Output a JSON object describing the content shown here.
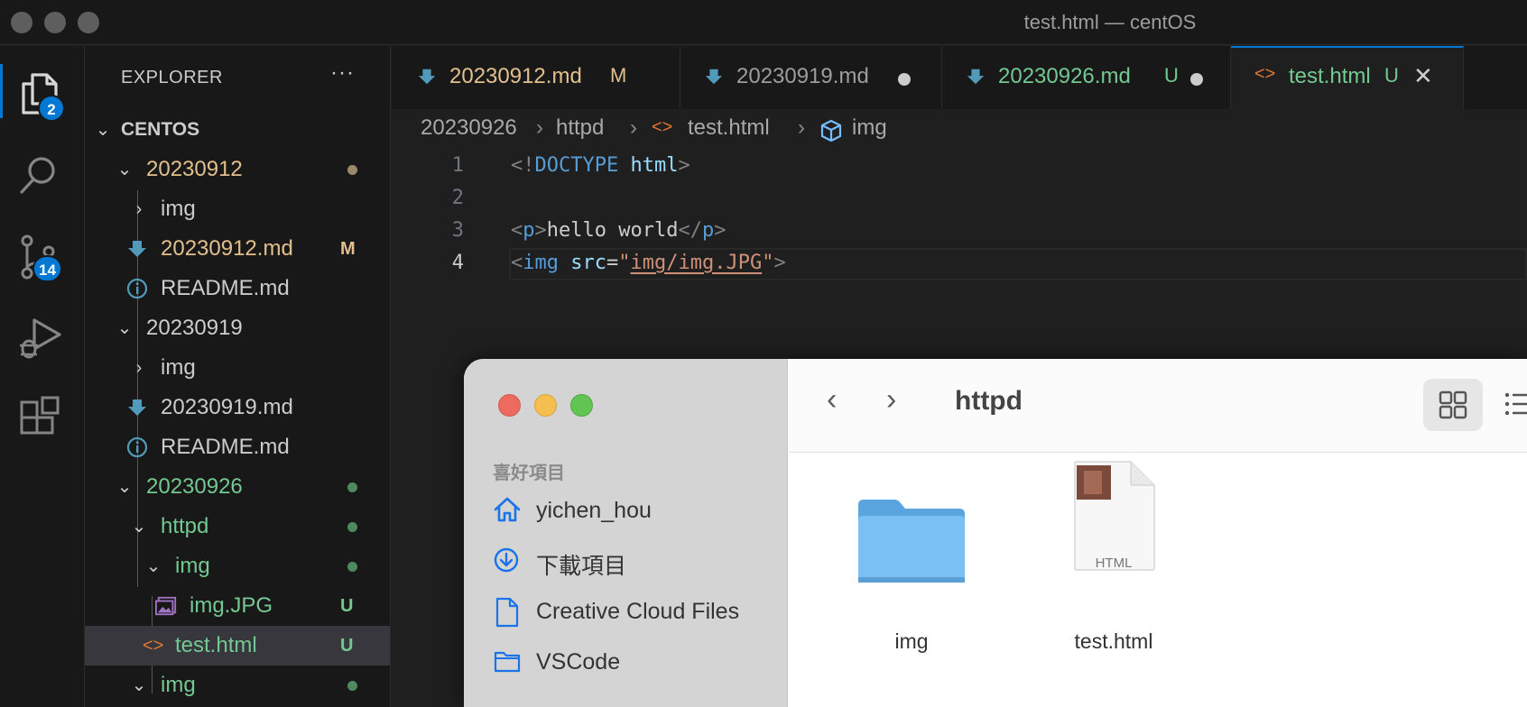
{
  "window": {
    "title": "test.html — centOS"
  },
  "activity": {
    "explorer_badge": "2",
    "scm_badge": "14",
    "icons": [
      "files-icon",
      "search-icon",
      "source-control-icon",
      "run-debug-icon",
      "extensions-icon"
    ]
  },
  "sidebar": {
    "header": "EXPLORER",
    "more": "···",
    "workspace": "CENTOS",
    "tree": [
      {
        "label": "20230912",
        "status": ""
      },
      {
        "label": "img",
        "status": ""
      },
      {
        "label": "20230912.md",
        "status": "M"
      },
      {
        "label": "README.md",
        "status": ""
      },
      {
        "label": "20230919",
        "status": ""
      },
      {
        "label": "img",
        "status": ""
      },
      {
        "label": "20230919.md",
        "status": ""
      },
      {
        "label": "README.md",
        "status": ""
      },
      {
        "label": "20230926",
        "status": ""
      },
      {
        "label": "httpd",
        "status": ""
      },
      {
        "label": "img",
        "status": ""
      },
      {
        "label": "img.JPG",
        "status": "U"
      },
      {
        "label": "test.html",
        "status": "U"
      },
      {
        "label": "img",
        "status": ""
      }
    ]
  },
  "tabs": [
    {
      "label": "20230912.md",
      "status": "M"
    },
    {
      "label": "20230919.md",
      "status": ""
    },
    {
      "label": "20230926.md",
      "status": "U"
    },
    {
      "label": "test.html",
      "status": "U",
      "close": "✕"
    }
  ],
  "breadcrumb": [
    "20230926",
    "httpd",
    "test.html",
    "img"
  ],
  "editor": {
    "line_numbers": [
      "1",
      "2",
      "3",
      "4"
    ],
    "line1": {
      "open": "<!",
      "keyword": "DOCTYPE",
      "name": "html",
      "close": ">"
    },
    "line3": {
      "lt": "<",
      "tag": "p",
      "gt": ">",
      "text": "hello world",
      "lt2": "</",
      "tag2": "p",
      "gt2": ">"
    },
    "line4": {
      "lt": "<",
      "tag": "img",
      "attr": "src",
      "eq": "=",
      "q1": "\"",
      "value": "img/img.JPG",
      "q2": "\"",
      "gt": ">"
    }
  },
  "finder": {
    "title": "httpd",
    "section": "喜好項目",
    "favorites": [
      {
        "label": "yichen_hou",
        "icon": "home-icon"
      },
      {
        "label": "下載項目",
        "icon": "download-icon"
      },
      {
        "label": "Creative Cloud Files",
        "icon": "document-icon"
      },
      {
        "label": "VSCode",
        "icon": "folder-icon"
      }
    ],
    "files": [
      {
        "label": "img",
        "icon": "folder-icon"
      },
      {
        "label": "test.html",
        "icon": "html-file-icon",
        "badge": "HTML"
      }
    ],
    "nav_back": "‹",
    "nav_forward": "›"
  },
  "colors": {
    "accent": "#0078d4",
    "modified": "#e2c08d",
    "untracked": "#73c991"
  }
}
